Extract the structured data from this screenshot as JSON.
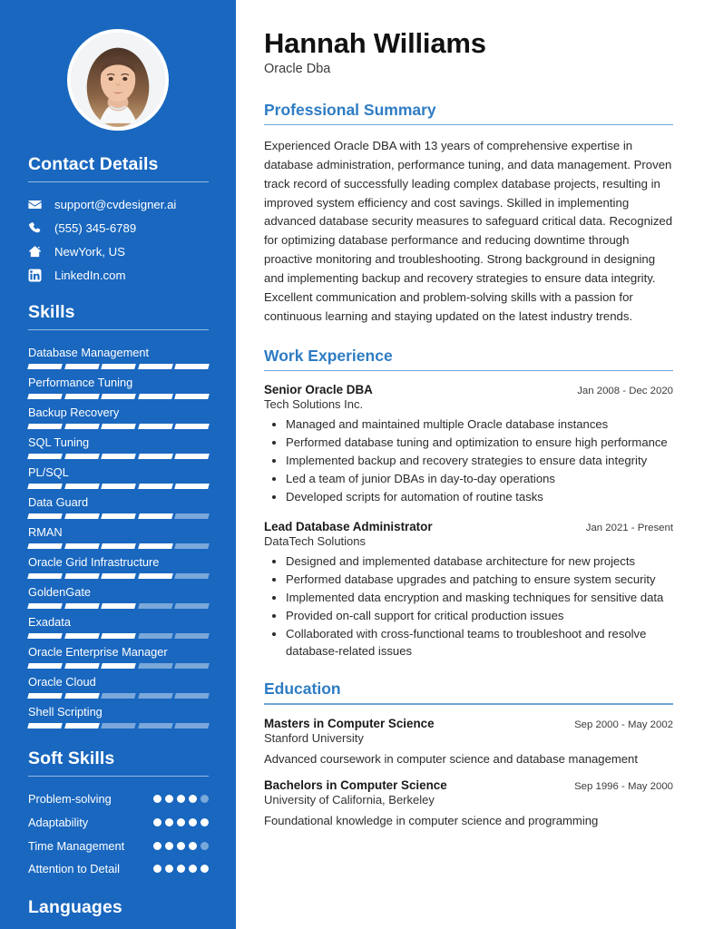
{
  "sidebar": {
    "avatar_alt": "profile-photo",
    "contact": {
      "heading": "Contact Details",
      "items": [
        {
          "icon": "envelope-icon",
          "value": "support@cvdesigner.ai"
        },
        {
          "icon": "phone-icon",
          "value": "(555) 345-6789"
        },
        {
          "icon": "home-icon",
          "value": "NewYork, US"
        },
        {
          "icon": "linkedin-icon",
          "value": "LinkedIn.com"
        }
      ]
    },
    "skills": {
      "heading": "Skills",
      "max_level": 5,
      "items": [
        {
          "name": "Database Management",
          "level": 5
        },
        {
          "name": "Performance Tuning",
          "level": 5
        },
        {
          "name": "Backup Recovery",
          "level": 5
        },
        {
          "name": "SQL Tuning",
          "level": 5
        },
        {
          "name": "PL/SQL",
          "level": 5
        },
        {
          "name": "Data Guard",
          "level": 4
        },
        {
          "name": "RMAN",
          "level": 4
        },
        {
          "name": "Oracle Grid Infrastructure",
          "level": 4
        },
        {
          "name": "GoldenGate",
          "level": 3
        },
        {
          "name": "Exadata",
          "level": 3
        },
        {
          "name": "Oracle Enterprise Manager",
          "level": 3
        },
        {
          "name": "Oracle Cloud",
          "level": 2
        },
        {
          "name": "Shell Scripting",
          "level": 2
        }
      ]
    },
    "soft_skills": {
      "heading": "Soft Skills",
      "max_level": 5,
      "items": [
        {
          "name": "Problem-solving",
          "level": 4
        },
        {
          "name": "Adaptability",
          "level": 5
        },
        {
          "name": "Time Management",
          "level": 4
        },
        {
          "name": "Attention to Detail",
          "level": 5
        }
      ]
    },
    "languages": {
      "heading": "Languages"
    }
  },
  "main": {
    "name": "Hannah Williams",
    "title": "Oracle Dba",
    "summary": {
      "heading": "Professional Summary",
      "text": "Experienced Oracle DBA with 13 years of comprehensive expertise in database administration, performance tuning, and data management. Proven track record of successfully leading complex database projects, resulting in improved system efficiency and cost savings. Skilled in implementing advanced database security measures to safeguard critical data. Recognized for optimizing database performance and reducing downtime through proactive monitoring and troubleshooting. Strong background in designing and implementing backup and recovery strategies to ensure data integrity. Excellent communication and problem-solving skills with a passion for continuous learning and staying updated on the latest industry trends."
    },
    "work": {
      "heading": "Work Experience",
      "jobs": [
        {
          "role": "Senior Oracle DBA",
          "company": "Tech Solutions Inc.",
          "dates": "Jan 2008 - Dec 2020",
          "bullets": [
            "Managed and maintained multiple Oracle database instances",
            "Performed database tuning and optimization to ensure high performance",
            "Implemented backup and recovery strategies to ensure data integrity",
            "Led a team of junior DBAs in day-to-day operations",
            "Developed scripts for automation of routine tasks"
          ]
        },
        {
          "role": "Lead Database Administrator",
          "company": "DataTech Solutions",
          "dates": "Jan 2021 - Present",
          "bullets": [
            "Designed and implemented database architecture for new projects",
            "Performed database upgrades and patching to ensure system security",
            "Implemented data encryption and masking techniques for sensitive data",
            "Provided on-call support for critical production issues",
            "Collaborated with cross-functional teams to troubleshoot and resolve database-related issues"
          ]
        }
      ]
    },
    "education": {
      "heading": "Education",
      "entries": [
        {
          "degree": "Masters in Computer Science",
          "school": "Stanford University",
          "dates": "Sep 2000 - May 2002",
          "description": "Advanced coursework in computer science and database management"
        },
        {
          "degree": "Bachelors in Computer Science",
          "school": "University of California, Berkeley",
          "dates": "Sep 1996 - May 2000",
          "description": "Foundational knowledge in computer science and programming"
        }
      ]
    }
  },
  "colors": {
    "sidebar_bg": "#1967bf",
    "accent_heading": "#2e7cc4",
    "accent_rule": "#6aa7d8",
    "bar_on": "#ffffff",
    "bar_off": "#7aa8da"
  }
}
